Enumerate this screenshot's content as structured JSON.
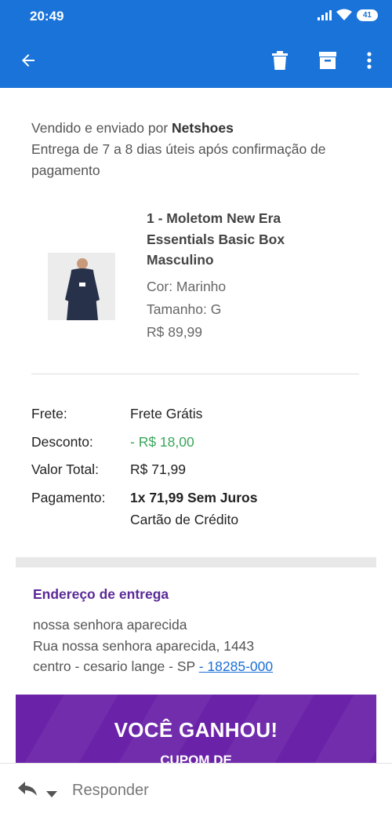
{
  "status_bar": {
    "time": "20:49",
    "battery": "41"
  },
  "toolbar": {
    "icons": [
      "back-arrow-icon",
      "trash-icon",
      "archive-icon",
      "more-vert-icon"
    ]
  },
  "order": {
    "seller_prefix": "Vendido e enviado por ",
    "seller_name": "Netshoes",
    "delivery_text": "Entrega de 7 a 8 dias úteis após confirmação de pagamento"
  },
  "product": {
    "name": "1 - Moletom New Era Essentials Basic Box Masculino",
    "color": "Cor: Marinho",
    "size": "Tamanho: G",
    "price": "R$ 89,99"
  },
  "summary": {
    "shipping_label": "Frete:",
    "shipping_value": "Frete Grátis",
    "discount_label": "Desconto:",
    "discount_value": "- R$ 18,00",
    "total_label": "Valor Total:",
    "total_value": "R$ 71,99",
    "payment_label": "Pagamento:",
    "payment_value": "1x 71,99 Sem Juros",
    "payment_method": "Cartão de Crédito"
  },
  "address": {
    "title": "Endereço de entrega",
    "line1": "nossa senhora aparecida",
    "line2": "Rua nossa senhora aparecida, 1443",
    "line3_prefix": "centro - cesario lange - SP ",
    "zip": "- 18285-000"
  },
  "promo": {
    "title": "VOCÊ GANHOU!",
    "subtitle": "CUPOM DE"
  },
  "bottom_bar": {
    "reply_label": "Responder"
  },
  "colors": {
    "primary": "#1a73d9",
    "discount": "#3aa65a",
    "address_title": "#5a2a96",
    "promo_bg": "#6a22a8",
    "link": "#1a6fd6"
  }
}
